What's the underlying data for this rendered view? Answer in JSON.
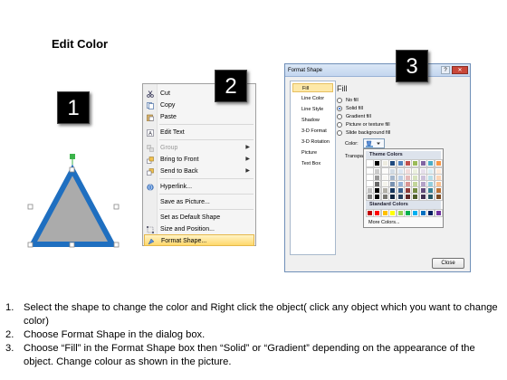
{
  "title": "Edit Color",
  "steps": {
    "one": "1",
    "two": "2",
    "three": "3"
  },
  "context_menu": {
    "items": [
      {
        "label": "Cut",
        "icon": "scissors-icon"
      },
      {
        "label": "Copy",
        "icon": "copy-icon"
      },
      {
        "label": "Paste",
        "icon": "paste-icon"
      },
      {
        "label": "Edit Text",
        "icon": "edit-text-icon"
      },
      {
        "label": "Group",
        "icon": "group-icon",
        "disabled": true,
        "submenu": true
      },
      {
        "label": "Bring to Front",
        "icon": "bring-to-front-icon",
        "submenu": true
      },
      {
        "label": "Send to Back",
        "icon": "send-to-back-icon",
        "submenu": true
      },
      {
        "label": "Hyperlink...",
        "icon": "hyperlink-icon"
      },
      {
        "label": "Save as Picture..."
      },
      {
        "label": "Set as Default Shape"
      },
      {
        "label": "Size and Position...",
        "icon": "size-position-icon"
      },
      {
        "label": "Format Shape...",
        "icon": "format-shape-icon",
        "highlighted": true
      }
    ]
  },
  "dialog": {
    "title": "Format Shape",
    "nav": [
      "Fill",
      "Line Color",
      "Line Style",
      "Shadow",
      "3-D Format",
      "3-D Rotation",
      "Picture",
      "Text Box"
    ],
    "selected_nav": "Fill",
    "fill_heading": "Fill",
    "options": [
      "No fill",
      "Solid fill",
      "Gradient fill",
      "Picture or texture fill",
      "Slide background fill"
    ],
    "selected_option": "Solid fill",
    "color_label": "Color:",
    "transparency_label": "Transpa",
    "close_label": "Close"
  },
  "palette": {
    "theme_heading": "Theme Colors",
    "standard_heading": "Standard Colors",
    "more_colors": "More Colors...",
    "theme_top": [
      "#ffffff",
      "#000000",
      "#eeece1",
      "#1f497d",
      "#4f81bd",
      "#c0504d",
      "#9bbb59",
      "#8064a2",
      "#4bacc6",
      "#f79646"
    ],
    "standard": [
      "#c00000",
      "#ff0000",
      "#ffc000",
      "#ffff00",
      "#92d050",
      "#00b050",
      "#00b0f0",
      "#0070c0",
      "#002060",
      "#7030a0"
    ]
  },
  "shape": {
    "fill": "#ababab",
    "stroke": "#1f6fc0"
  },
  "instructions": [
    {
      "num": "1.",
      "text": "Select the shape to change the color and Right click the object( click any object which you want to change color)"
    },
    {
      "num": "2.",
      "text": "Choose Format Shape in the dialog box."
    },
    {
      "num": "3.",
      "text": "Choose “Fill” in the Format Shape box then “Solid” or “Gradient” depending on the appearance of the object. Change colour as shown in the picture."
    }
  ]
}
